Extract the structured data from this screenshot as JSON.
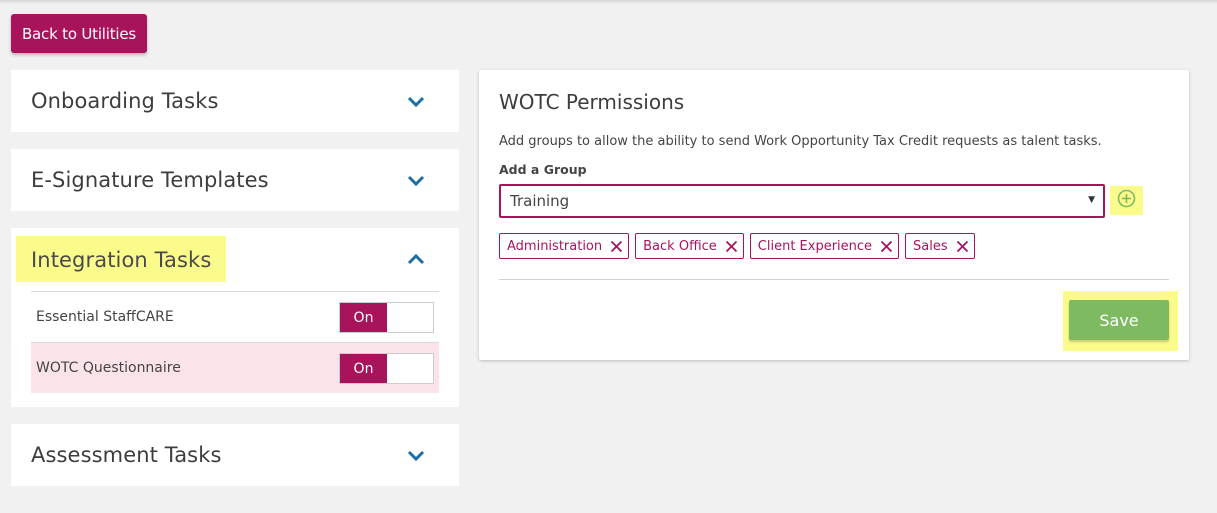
{
  "colors": {
    "brand": "#a8145c",
    "highlight": "#fbfb8c",
    "save": "#7dba60",
    "row_selected": "#fbe3ea",
    "chevron": "#1a6fa8"
  },
  "back_button": {
    "label": "Back to Utilities"
  },
  "sections": [
    {
      "title": "Onboarding Tasks",
      "state": "collapsed",
      "icon": "chevron-down-icon"
    },
    {
      "title": "E-Signature Templates",
      "state": "collapsed",
      "icon": "chevron-down-icon"
    },
    {
      "title": "Integration Tasks",
      "state": "expanded",
      "icon": "chevron-up-icon",
      "items": [
        {
          "label": "Essential StaffCARE",
          "toggle_label": "On",
          "toggle_on": true
        },
        {
          "label": "WOTC Questionnaire",
          "toggle_label": "On",
          "toggle_on": true,
          "selected": true
        }
      ]
    },
    {
      "title": "Assessment Tasks",
      "state": "collapsed",
      "icon": "chevron-down-icon"
    }
  ],
  "wotc": {
    "title": "WOTC Permissions",
    "description": "Add groups to allow the ability to send Work Opportunity Tax Credit requests as talent tasks.",
    "add_group_label": "Add a Group",
    "selected_group": "Training",
    "add_icon": "plus-circle-icon",
    "groups": [
      "Administration",
      "Back Office",
      "Client Experience",
      "Sales"
    ],
    "save_label": "Save"
  }
}
